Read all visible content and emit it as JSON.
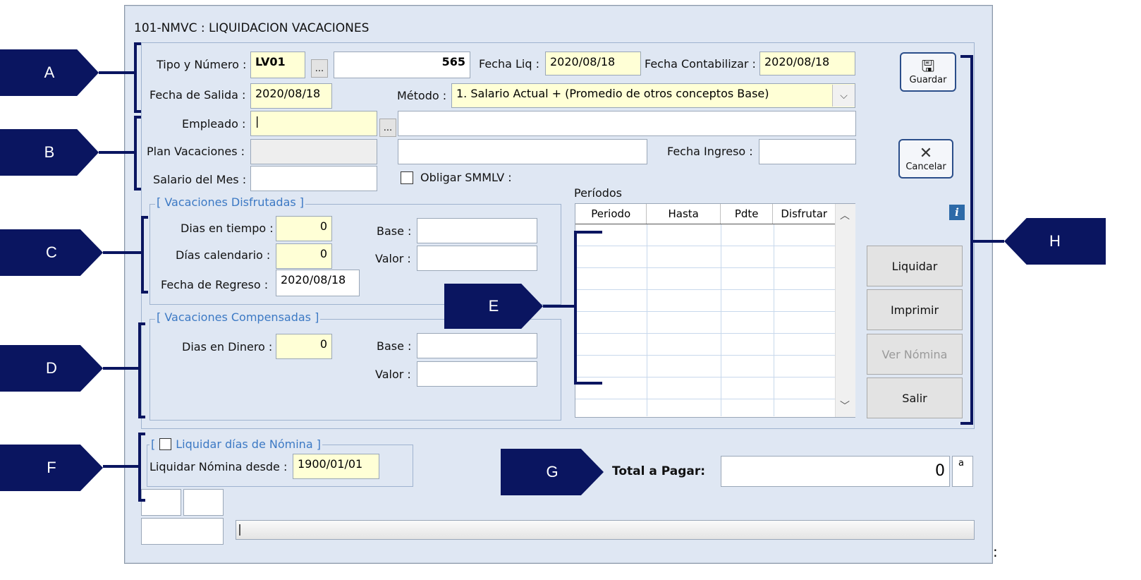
{
  "window": {
    "title": "101-NMVC : LIQUIDACION VACACIONES"
  },
  "header": {
    "tipo_label": "Tipo y Número :",
    "tipo_value": "LV01",
    "lookup_btn": "...",
    "numero_value": "565",
    "fecha_liq_label": "Fecha Liq :",
    "fecha_liq_value": "2020/08/18",
    "fecha_contab_label": "Fecha Contabilizar :",
    "fecha_contab_value": "2020/08/18",
    "fecha_salida_label": "Fecha de Salida :",
    "fecha_salida_value": "2020/08/18",
    "metodo_label": "Método :",
    "metodo_value": "1. Salario Actual + (Promedio de otros conceptos Base)"
  },
  "employee": {
    "empleado_label": "Empleado :",
    "empleado_value": "|",
    "plan_label": "Plan Vacaciones :",
    "fecha_ingreso_label": "Fecha Ingreso :",
    "salario_label": "Salario del Mes :",
    "smmlv_label": "Obligar SMMLV :"
  },
  "disfrutadas": {
    "title": "[ Vacaciones Disfrutadas ]",
    "dias_tiempo_label": "Dias en tiempo :",
    "dias_tiempo_value": "0",
    "dias_cal_label": "Días calendario :",
    "dias_cal_value": "0",
    "fecha_regreso_label": "Fecha de Regreso :",
    "fecha_regreso_value": "2020/08/18",
    "base_label": "Base :",
    "valor_label": "Valor :"
  },
  "compensadas": {
    "title": "[ Vacaciones Compensadas ]",
    "dias_dinero_label": "Dias en Dinero :",
    "dias_dinero_value": "0",
    "base_label": "Base :",
    "valor_label": "Valor :"
  },
  "periodos": {
    "label": "Períodos",
    "columns": [
      "Periodo",
      "Hasta",
      "Pdte",
      "Disfrutar"
    ]
  },
  "nomina": {
    "title_open": "[",
    "title": "Liquidar días de Nómina ]",
    "desde_label": "Liquidar Nómina desde :",
    "desde_value": "1900/01/01"
  },
  "total": {
    "label": "Total  a Pagar:",
    "value": "0",
    "suffix": "a"
  },
  "buttons": {
    "guardar": "Guardar",
    "cancelar": "Cancelar",
    "info": "i",
    "liquidar": "Liquidar",
    "imprimir": "Imprimir",
    "ver_nomina": "Ver Nómina",
    "salir": "Salir"
  },
  "callouts": [
    "A",
    "B",
    "C",
    "D",
    "E",
    "F",
    "G",
    "H"
  ],
  "trailing_mark": ":",
  "colors": {
    "callout": "#0a1560",
    "group_title": "#3c79c4",
    "required_field": "#ffffd6"
  }
}
